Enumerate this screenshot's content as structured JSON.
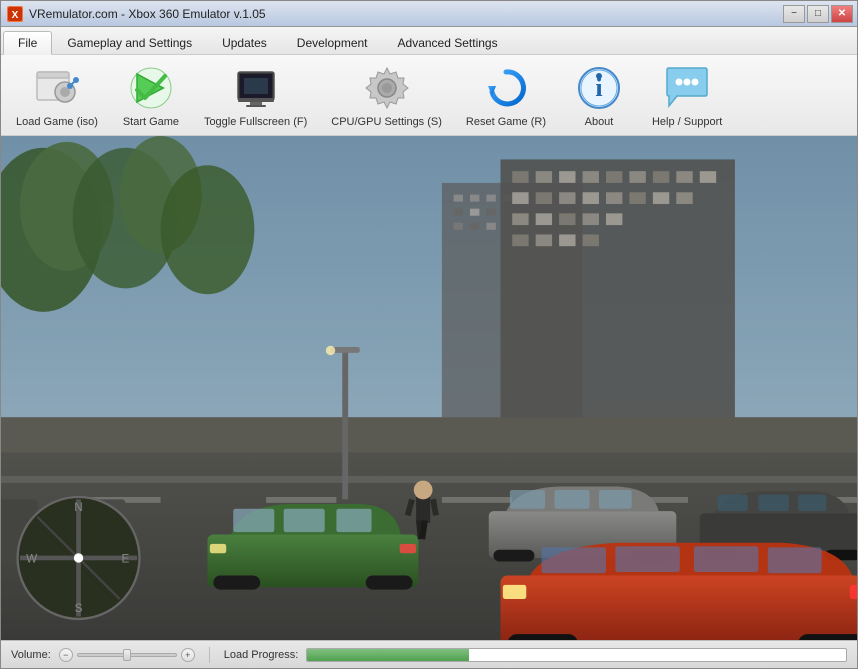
{
  "window": {
    "title": "VRemulator.com - Xbox 360 Emulator v.1.05",
    "icon_label": "X"
  },
  "titlebar": {
    "minimize_label": "−",
    "maximize_label": "□",
    "close_label": "✕"
  },
  "menu": {
    "tabs": [
      {
        "id": "file",
        "label": "File",
        "active": true
      },
      {
        "id": "gameplay",
        "label": "Gameplay and Settings",
        "active": false
      },
      {
        "id": "updates",
        "label": "Updates",
        "active": false
      },
      {
        "id": "development",
        "label": "Development",
        "active": false
      },
      {
        "id": "advanced",
        "label": "Advanced Settings",
        "active": false
      }
    ]
  },
  "toolbar": {
    "items": [
      {
        "id": "load-game",
        "label": "Load Game (iso)",
        "icon": "load-game-icon"
      },
      {
        "id": "start-game",
        "label": "Start Game",
        "icon": "start-game-icon"
      },
      {
        "id": "toggle-fullscreen",
        "label": "Toggle Fullscreen (F)",
        "icon": "fullscreen-icon"
      },
      {
        "id": "cpu-gpu-settings",
        "label": "CPU/GPU Settings (S)",
        "icon": "settings-icon"
      },
      {
        "id": "reset-game",
        "label": "Reset Game (R)",
        "icon": "reset-icon"
      },
      {
        "id": "about",
        "label": "About",
        "icon": "about-icon"
      },
      {
        "id": "help-support",
        "label": "Help / Support",
        "icon": "help-icon"
      }
    ]
  },
  "statusbar": {
    "volume_label": "Volume:",
    "progress_label": "Load Progress:",
    "progress_value": 30
  }
}
